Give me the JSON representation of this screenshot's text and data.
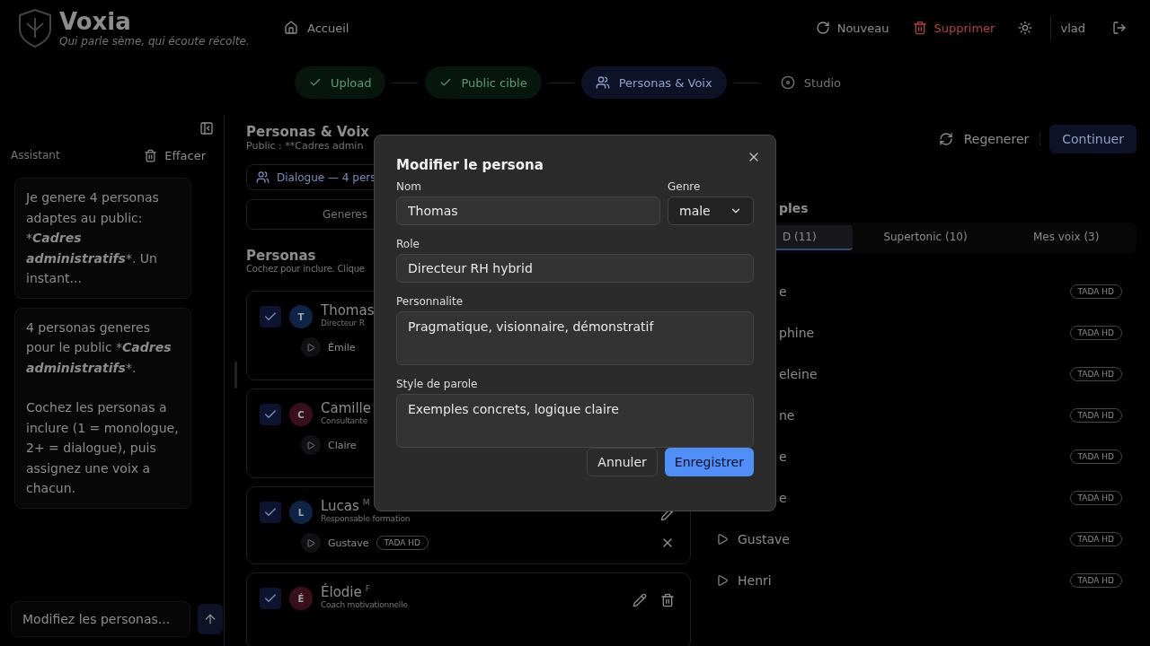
{
  "header": {
    "brand": "Voxia",
    "tagline": "Qui parle sème, qui écoute récolte.",
    "nav": [
      {
        "label": "Accueil"
      }
    ],
    "actions": [
      {
        "kind": "refresh",
        "label": "Nouveau"
      },
      {
        "kind": "delete",
        "label": "Supprimer"
      }
    ],
    "user": "vlad"
  },
  "steps": [
    {
      "label": "Upload",
      "completed": true,
      "selected": false
    },
    {
      "label": "Public cible",
      "completed": true,
      "selected": false
    },
    {
      "label": "Personas & Voix",
      "completed": false,
      "selected": true
    },
    {
      "label": "Studio",
      "completed": false,
      "selected": false
    }
  ],
  "assistant": {
    "title": "Assistant",
    "clear": "Effacer",
    "placeholder": "Modifiez les personas...",
    "messages": [
      {
        "paragraphs": [
          [
            {
              "text": "Je genere 4 personas adaptes au public: *",
              "emphasis": false
            },
            {
              "text": "Cadres administratifs",
              "emphasis": true
            },
            {
              "text": "*. Un instant...",
              "emphasis": false
            }
          ]
        ]
      },
      {
        "paragraphs": [
          [
            {
              "text": "4 personas generes pour le public *",
              "emphasis": false
            },
            {
              "text": "Cadres administratifs",
              "emphasis": true
            },
            {
              "text": "*.",
              "emphasis": false
            }
          ],
          [
            {
              "text": "Cochez les personas a inclure (1 = monologue, 2+ = dialogue), puis assignez une voix a chacun.",
              "emphasis": false
            }
          ]
        ]
      }
    ]
  },
  "personas_panel": {
    "title": "Personas & Voix",
    "subtitle": "Public : **Cadres admin",
    "mode": "Dialogue — 4 pers",
    "generated": "Generes",
    "section": "Personas",
    "hint": "Cochez pour inclure. Clique",
    "personas": [
      {
        "name": "Thomas",
        "initial": "T",
        "color": "#0f2444",
        "checked": true,
        "role": "Directeur R",
        "voice": "Émile"
      },
      {
        "name": "Camille",
        "initial": "C",
        "color": "#3a0f1c",
        "checked": true,
        "role": "Consultante",
        "voice": "Claire"
      },
      {
        "name": "Lucas",
        "gender": "M",
        "initial": "L",
        "color": "#0f2444",
        "checked": true,
        "role": "Responsable formation",
        "voice": "Gustave",
        "badge": "TADA HD",
        "editable": true,
        "removable": true
      },
      {
        "name": "Élodie",
        "gender": "F",
        "initial": "É",
        "color": "#3a0f1c",
        "checked": true,
        "role": "Coach motivationnelle",
        "editable": true,
        "deletable": true
      }
    ]
  },
  "voices_panel": {
    "regenerate": "Regenerer",
    "continue": "Continuer",
    "heading": "ples",
    "tabs": [
      {
        "label": "D (11)",
        "selected": true
      },
      {
        "label": "Supertonic (10)",
        "selected": false
      },
      {
        "label": "Mes voix (3)",
        "selected": false
      }
    ],
    "voices": [
      {
        "name": "e",
        "kind": "partial",
        "badge": "TADA HD"
      },
      {
        "name": "phine",
        "kind": "partial",
        "badge": "TADA HD"
      },
      {
        "name": "eleine",
        "kind": "partial",
        "badge": "TADA HD"
      },
      {
        "name": "ne",
        "kind": "partial",
        "badge": "TADA HD"
      },
      {
        "name": "e",
        "kind": "partial",
        "badge": "TADA HD"
      },
      {
        "name": "e",
        "kind": "partial",
        "badge": "TADA HD"
      },
      {
        "name": "Gustave",
        "kind": "full",
        "badge": "TADA HD"
      },
      {
        "name": "Henri",
        "kind": "full",
        "badge": "TADA HD"
      }
    ]
  },
  "dialog": {
    "title": "Modifier le persona",
    "fields": [
      {
        "label": "Nom",
        "value": "Thomas",
        "kind": "input"
      },
      {
        "label": "Genre",
        "value": "male",
        "kind": "select"
      },
      {
        "label": "Role",
        "value": "Directeur RH hybrid",
        "kind": "input"
      },
      {
        "label": "Personnalite",
        "value": "Pragmatique, visionnaire, démonstratif",
        "kind": "textarea"
      },
      {
        "label": "Style de parole",
        "value": "Exemples concrets, logique claire",
        "kind": "textarea"
      }
    ],
    "buttons": [
      {
        "label": "Annuler",
        "kind": "secondary"
      },
      {
        "label": "Enregistrer",
        "kind": "primary"
      }
    ]
  }
}
